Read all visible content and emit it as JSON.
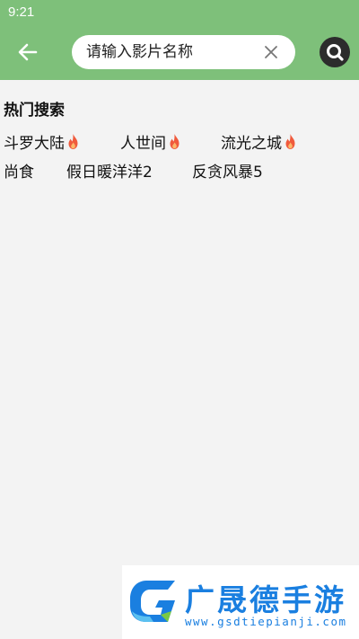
{
  "status_bar": {
    "time": "9:21"
  },
  "header": {
    "back_icon": "arrow-left-icon",
    "search": {
      "placeholder": "请输入影片名称",
      "value": ""
    },
    "clear_icon": "close-icon",
    "search_icon": "search-icon"
  },
  "hot_search": {
    "title": "热门搜索",
    "items": [
      {
        "label": "斗罗大陆",
        "hot": true
      },
      {
        "label": "人世间",
        "hot": true
      },
      {
        "label": "流光之城",
        "hot": true
      },
      {
        "label": "尚食",
        "hot": false
      },
      {
        "label": "假日暖洋洋2",
        "hot": false
      },
      {
        "label": "反贪风暴5",
        "hot": false
      }
    ]
  },
  "watermark": {
    "name": "广晟德手游",
    "url": "www.gsdtiepianji.com"
  },
  "colors": {
    "header": "#7ec07a",
    "background": "#f3f3f3",
    "fire": "#f05a3c",
    "watermark": "#1a7fe0"
  }
}
